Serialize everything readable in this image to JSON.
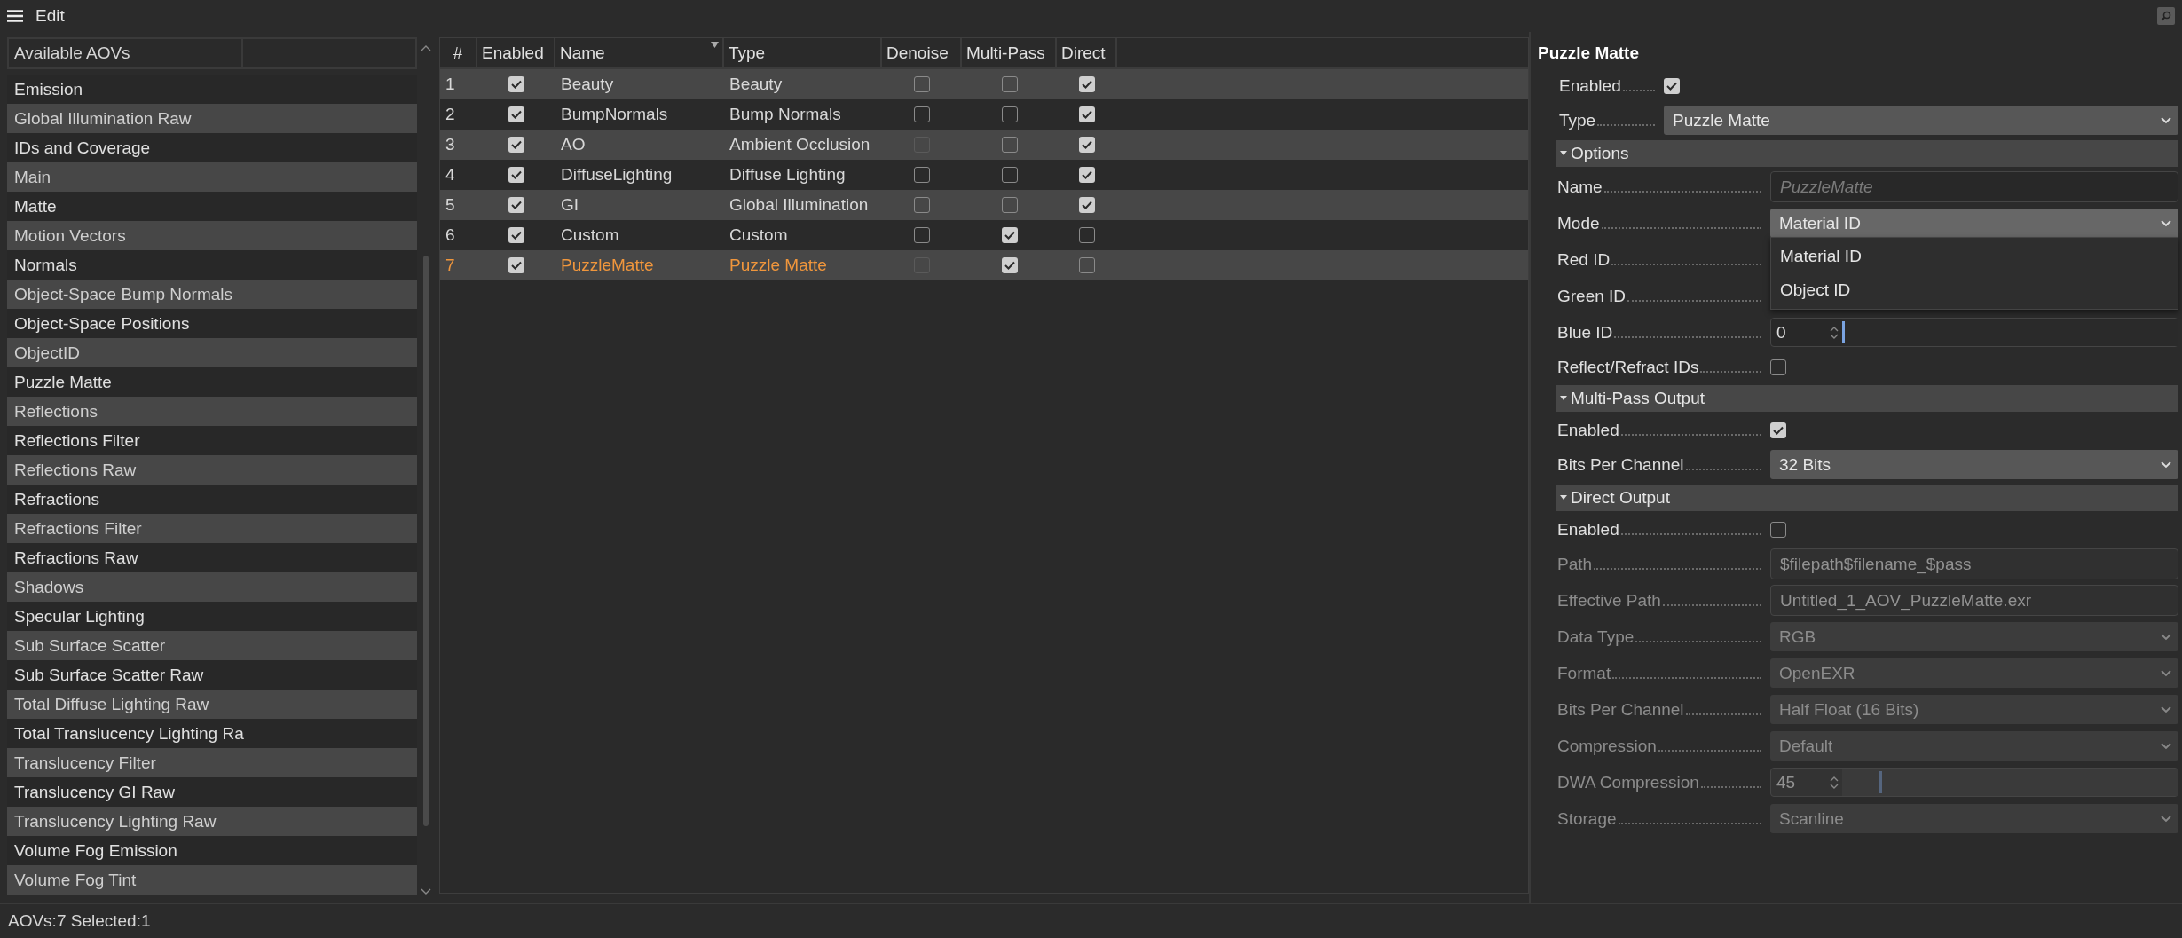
{
  "menu": {
    "label": "Edit"
  },
  "available_aovs": {
    "header": "Available AOVs",
    "items": [
      "Emission",
      "Global Illumination Raw",
      "IDs and Coverage",
      "Main",
      "Matte",
      "Motion Vectors",
      "Normals",
      "Object-Space Bump Normals",
      "Object-Space Positions",
      "ObjectID",
      "Puzzle Matte",
      "Reflections",
      "Reflections Filter",
      "Reflections Raw",
      "Refractions",
      "Refractions Filter",
      "Refractions Raw",
      "Shadows",
      "Specular Lighting",
      "Sub Surface Scatter",
      "Sub Surface Scatter Raw",
      "Total Diffuse Lighting Raw",
      "Total Translucency Lighting Ra",
      "Translucency Filter",
      "Translucency GI Raw",
      "Translucency Lighting Raw",
      "Volume Fog Emission",
      "Volume Fog Tint"
    ]
  },
  "aov_table": {
    "columns": [
      {
        "label": "#",
        "sorted": false
      },
      {
        "label": "Enabled",
        "sorted": false
      },
      {
        "label": "Name",
        "sorted": true
      },
      {
        "label": "Type",
        "sorted": false
      },
      {
        "label": "Denoise",
        "sorted": false
      },
      {
        "label": "Multi-Pass",
        "sorted": false
      },
      {
        "label": "Direct",
        "sorted": false
      }
    ],
    "rows": [
      {
        "index": "1",
        "enabled": true,
        "name": "Beauty",
        "type": "Beauty",
        "denoise": {
          "checked": false,
          "disabled": false
        },
        "multi_pass": {
          "checked": false,
          "disabled": false
        },
        "direct": {
          "checked": true,
          "disabled": false
        },
        "selected": false
      },
      {
        "index": "2",
        "enabled": true,
        "name": "BumpNormals",
        "type": "Bump Normals",
        "denoise": {
          "checked": false,
          "disabled": false
        },
        "multi_pass": {
          "checked": false,
          "disabled": false
        },
        "direct": {
          "checked": true,
          "disabled": false
        },
        "selected": false
      },
      {
        "index": "3",
        "enabled": true,
        "name": "AO",
        "type": "Ambient Occlusion",
        "denoise": {
          "checked": false,
          "disabled": true
        },
        "multi_pass": {
          "checked": false,
          "disabled": false
        },
        "direct": {
          "checked": true,
          "disabled": false
        },
        "selected": false
      },
      {
        "index": "4",
        "enabled": true,
        "name": "DiffuseLighting",
        "type": "Diffuse Lighting",
        "denoise": {
          "checked": false,
          "disabled": false
        },
        "multi_pass": {
          "checked": false,
          "disabled": false
        },
        "direct": {
          "checked": true,
          "disabled": false
        },
        "selected": false
      },
      {
        "index": "5",
        "enabled": true,
        "name": "GI",
        "type": "Global Illumination",
        "denoise": {
          "checked": false,
          "disabled": false
        },
        "multi_pass": {
          "checked": false,
          "disabled": false
        },
        "direct": {
          "checked": true,
          "disabled": false
        },
        "selected": false
      },
      {
        "index": "6",
        "enabled": true,
        "name": "Custom",
        "type": "Custom",
        "denoise": {
          "checked": false,
          "disabled": false
        },
        "multi_pass": {
          "checked": true,
          "disabled": false
        },
        "direct": {
          "checked": false,
          "disabled": false
        },
        "selected": false
      },
      {
        "index": "7",
        "enabled": true,
        "name": "PuzzleMatte",
        "type": "Puzzle Matte",
        "denoise": {
          "checked": false,
          "disabled": true
        },
        "multi_pass": {
          "checked": true,
          "disabled": false
        },
        "direct": {
          "checked": false,
          "disabled": false
        },
        "selected": true
      }
    ]
  },
  "properties": {
    "title": "Puzzle Matte",
    "general": [
      {
        "kind": "checkbox",
        "label": "Enabled",
        "checked": true,
        "disabled": false
      },
      {
        "kind": "select",
        "label": "Type",
        "value": "Puzzle Matte",
        "disabled": false
      }
    ],
    "sections": [
      {
        "title": "Options",
        "expanded": true,
        "rows": [
          {
            "kind": "text",
            "label": "Name",
            "placeholder": "PuzzleMatte",
            "disabled": false
          },
          {
            "kind": "select",
            "label": "Mode",
            "value": "Material ID",
            "disabled": false,
            "open": true,
            "options": [
              "Material ID",
              "Object ID"
            ]
          },
          {
            "kind": "covered",
            "label": "Red ID"
          },
          {
            "kind": "covered",
            "label": "Green ID"
          },
          {
            "kind": "spinner_slider",
            "label": "Blue ID",
            "value": "0",
            "level": 0,
            "disabled": false
          },
          {
            "kind": "checkbox",
            "label": "Reflect/Refract IDs",
            "checked": false,
            "disabled": false
          }
        ]
      },
      {
        "title": "Multi-Pass Output",
        "expanded": true,
        "rows": [
          {
            "kind": "checkbox",
            "label": "Enabled",
            "checked": true,
            "disabled": false
          },
          {
            "kind": "select",
            "label": "Bits Per Channel",
            "value": "32 Bits",
            "disabled": false
          }
        ]
      },
      {
        "title": "Direct Output",
        "expanded": true,
        "rows": [
          {
            "kind": "checkbox",
            "label": "Enabled",
            "checked": false,
            "disabled": false
          },
          {
            "kind": "text",
            "label": "Path",
            "value": "$filepath$filename_$pass",
            "disabled": true
          },
          {
            "kind": "text",
            "label": "Effective Path",
            "value": "Untitled_1_AOV_PuzzleMatte.exr",
            "disabled": true
          },
          {
            "kind": "select",
            "label": "Data Type",
            "value": "RGB",
            "disabled": true
          },
          {
            "kind": "select",
            "label": "Format",
            "value": "OpenEXR",
            "disabled": true
          },
          {
            "kind": "select",
            "label": "Bits Per Channel",
            "value": "Half Float (16 Bits)",
            "disabled": true
          },
          {
            "kind": "select",
            "label": "Compression",
            "value": "Default",
            "disabled": true
          },
          {
            "kind": "spinner_slider",
            "label": "DWA Compression",
            "value": "45",
            "level": 0.11,
            "disabled": true
          },
          {
            "kind": "select",
            "label": "Storage",
            "value": "Scanline",
            "disabled": true
          }
        ]
      }
    ]
  },
  "status_bar": {
    "text": "AOVs:7 Selected:1"
  }
}
